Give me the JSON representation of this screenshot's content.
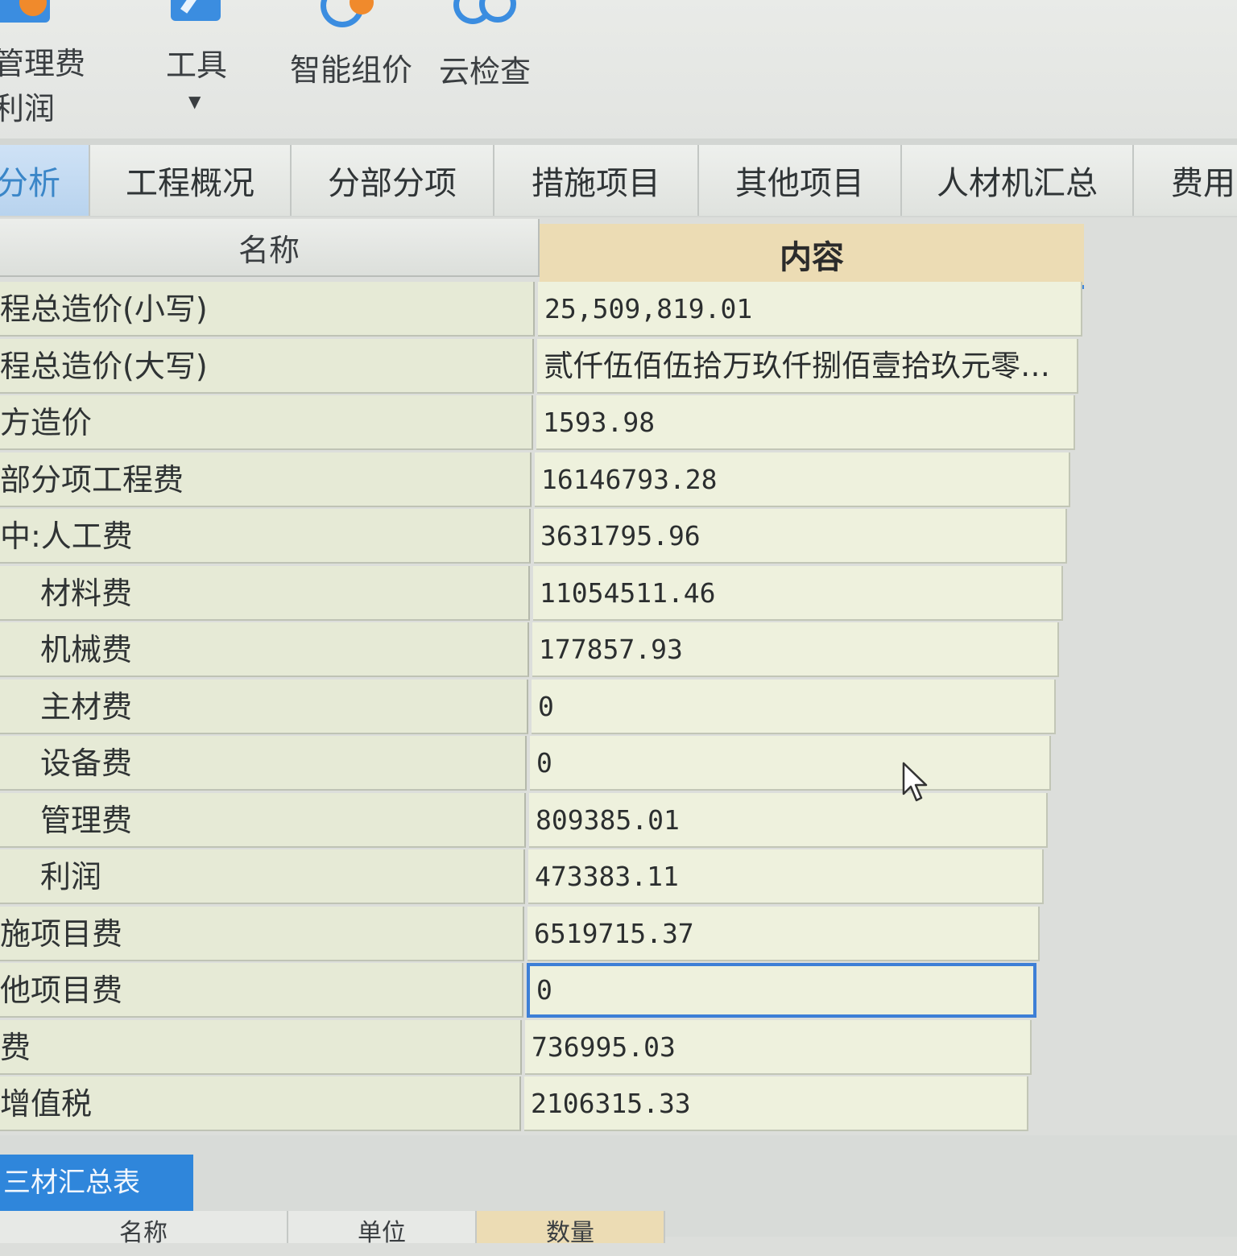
{
  "ribbon": {
    "fee_button": {
      "label": "管理费",
      "sublabel": "利润"
    },
    "tools_button": {
      "label": "工具",
      "caret": "▼"
    },
    "smart_price_button": {
      "label": "智能组价"
    },
    "cloud_check_button": {
      "label": "云检查"
    },
    "icons": [
      "fee-settings-icon",
      "tools-icon",
      "smart-price-icon",
      "cloud-check-icon"
    ]
  },
  "tabs": [
    {
      "label": "分析",
      "active": true
    },
    {
      "label": "工程概况",
      "active": false
    },
    {
      "label": "分部分项",
      "active": false
    },
    {
      "label": "措施项目",
      "active": false
    },
    {
      "label": "其他项目",
      "active": false
    },
    {
      "label": "人材机汇总",
      "active": false
    },
    {
      "label": "费用",
      "active": false
    }
  ],
  "table": {
    "headers": {
      "name": "名称",
      "content": "内容"
    },
    "rows": [
      {
        "name": "程总造价(小写)",
        "value": "25,509,819.01"
      },
      {
        "name": "程总造价(大写)",
        "value": "贰仟伍佰伍拾万玖仟捌佰壹拾玖元零…"
      },
      {
        "name": "方造价",
        "value": "1593.98"
      },
      {
        "name": "部分项工程费",
        "value": "16146793.28"
      },
      {
        "name": "中:人工费",
        "value": "3631795.96"
      },
      {
        "name": "材料费",
        "value": "11054511.46"
      },
      {
        "name": "机械费",
        "value": "177857.93"
      },
      {
        "name": "主材费",
        "value": "0"
      },
      {
        "name": "设备费",
        "value": "0"
      },
      {
        "name": "管理费",
        "value": "809385.01"
      },
      {
        "name": "利润",
        "value": "473383.11"
      },
      {
        "name": "施项目费",
        "value": "6519715.37"
      },
      {
        "name": "他项目费",
        "value": "0",
        "selected": true
      },
      {
        "name": "费",
        "value": "736995.03"
      },
      {
        "name": "增值税",
        "value": "2106315.33"
      }
    ]
  },
  "bottom_panel": {
    "tab_label": "三材汇总表",
    "headers": [
      "名称",
      "单位",
      "数量"
    ]
  },
  "colors": {
    "accent": "#3f86d8",
    "content_header": "#ecdcb4",
    "name_cell": "#e6ead6",
    "value_cell": "#eef1dd"
  }
}
